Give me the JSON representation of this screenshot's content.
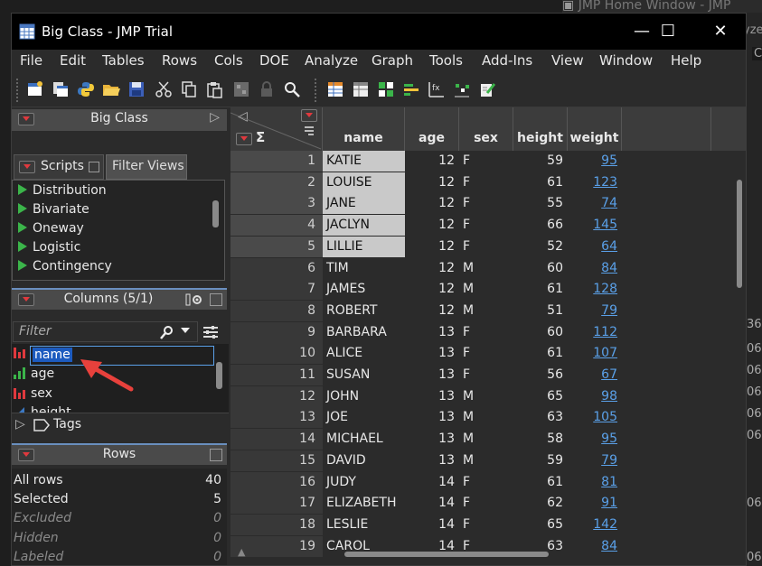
{
  "background_window": {
    "title": "JMP Home Window - JMP",
    "fragments": [
      "yze",
      "C",
      "36",
      "06",
      "06",
      "06",
      "06",
      "06",
      "06",
      "06"
    ]
  },
  "window": {
    "title": "Big Class - JMP Trial",
    "controls": {
      "minimize": "—",
      "maximize": "☐",
      "close": "✕"
    }
  },
  "menu": [
    "File",
    "Edit",
    "Tables",
    "Rows",
    "Cols",
    "DOE",
    "Analyze",
    "Graph",
    "Tools",
    "Add-Ins",
    "View",
    "Window",
    "Help"
  ],
  "toolbar_icons": [
    "new-table-icon",
    "open-data-table-icon",
    "python-icon",
    "open-folder-icon",
    "save-icon",
    "cut-icon",
    "copy-icon",
    "paste-icon",
    "calculator-icon",
    "lock-icon",
    "search-icon",
    "data-grid-icon",
    "table-icon",
    "grid-view-icon",
    "bar-chart-icon",
    "formula-icon",
    "scatter-icon",
    "script-icon"
  ],
  "left_panel": {
    "table_outline": {
      "title": "Big Class"
    },
    "tabs": {
      "scripts": "Scripts",
      "filter_views": "Filter Views"
    },
    "scripts": [
      "Distribution",
      "Bivariate",
      "Oneway",
      "Logistic",
      "Contingency"
    ],
    "columns": {
      "title": "Columns (5/1)",
      "filter_placeholder": "Filter",
      "editing_value": "name",
      "items": [
        "age",
        "sex",
        "height"
      ]
    },
    "tags_label": "Tags",
    "rows": {
      "title": "Rows",
      "stats": [
        {
          "label": "All rows",
          "value": "40"
        },
        {
          "label": "Selected",
          "value": "5"
        },
        {
          "label": "Excluded",
          "value": "0"
        },
        {
          "label": "Hidden",
          "value": "0"
        },
        {
          "label": "Labeled",
          "value": "0"
        }
      ]
    }
  },
  "grid": {
    "sum_symbol": "Σ",
    "columns": [
      "name",
      "age",
      "sex",
      "height",
      "weight"
    ],
    "rows": [
      {
        "n": "1",
        "name": "KATIE",
        "age": "12",
        "sex": "F",
        "height": "59",
        "weight": "95",
        "selected": true
      },
      {
        "n": "2",
        "name": "LOUISE",
        "age": "12",
        "sex": "F",
        "height": "61",
        "weight": "123",
        "selected": true
      },
      {
        "n": "3",
        "name": "JANE",
        "age": "12",
        "sex": "F",
        "height": "55",
        "weight": "74",
        "selected": true
      },
      {
        "n": "4",
        "name": "JACLYN",
        "age": "12",
        "sex": "F",
        "height": "66",
        "weight": "145",
        "selected": true
      },
      {
        "n": "5",
        "name": "LILLIE",
        "age": "12",
        "sex": "F",
        "height": "52",
        "weight": "64",
        "selected": true
      },
      {
        "n": "6",
        "name": "TIM",
        "age": "12",
        "sex": "M",
        "height": "60",
        "weight": "84",
        "selected": false
      },
      {
        "n": "7",
        "name": "JAMES",
        "age": "12",
        "sex": "M",
        "height": "61",
        "weight": "128",
        "selected": false
      },
      {
        "n": "8",
        "name": "ROBERT",
        "age": "12",
        "sex": "M",
        "height": "51",
        "weight": "79",
        "selected": false
      },
      {
        "n": "9",
        "name": "BARBARA",
        "age": "13",
        "sex": "F",
        "height": "60",
        "weight": "112",
        "selected": false
      },
      {
        "n": "10",
        "name": "ALICE",
        "age": "13",
        "sex": "F",
        "height": "61",
        "weight": "107",
        "selected": false
      },
      {
        "n": "11",
        "name": "SUSAN",
        "age": "13",
        "sex": "F",
        "height": "56",
        "weight": "67",
        "selected": false
      },
      {
        "n": "12",
        "name": "JOHN",
        "age": "13",
        "sex": "M",
        "height": "65",
        "weight": "98",
        "selected": false
      },
      {
        "n": "13",
        "name": "JOE",
        "age": "13",
        "sex": "M",
        "height": "63",
        "weight": "105",
        "selected": false
      },
      {
        "n": "14",
        "name": "MICHAEL",
        "age": "13",
        "sex": "M",
        "height": "58",
        "weight": "95",
        "selected": false
      },
      {
        "n": "15",
        "name": "DAVID",
        "age": "13",
        "sex": "M",
        "height": "59",
        "weight": "79",
        "selected": false
      },
      {
        "n": "16",
        "name": "JUDY",
        "age": "14",
        "sex": "F",
        "height": "61",
        "weight": "81",
        "selected": false
      },
      {
        "n": "17",
        "name": "ELIZABETH",
        "age": "14",
        "sex": "F",
        "height": "62",
        "weight": "91",
        "selected": false
      },
      {
        "n": "18",
        "name": "LESLIE",
        "age": "14",
        "sex": "F",
        "height": "65",
        "weight": "142",
        "selected": false
      },
      {
        "n": "19",
        "name": "CAROL",
        "age": "14",
        "sex": "F",
        "height": "63",
        "weight": "84",
        "selected": false
      }
    ]
  },
  "colors": {
    "accent": "#6a8fbf",
    "link": "#5aa0e8",
    "annotation_arrow": "#e8413c",
    "selected_cell": "#c9c9c9"
  }
}
